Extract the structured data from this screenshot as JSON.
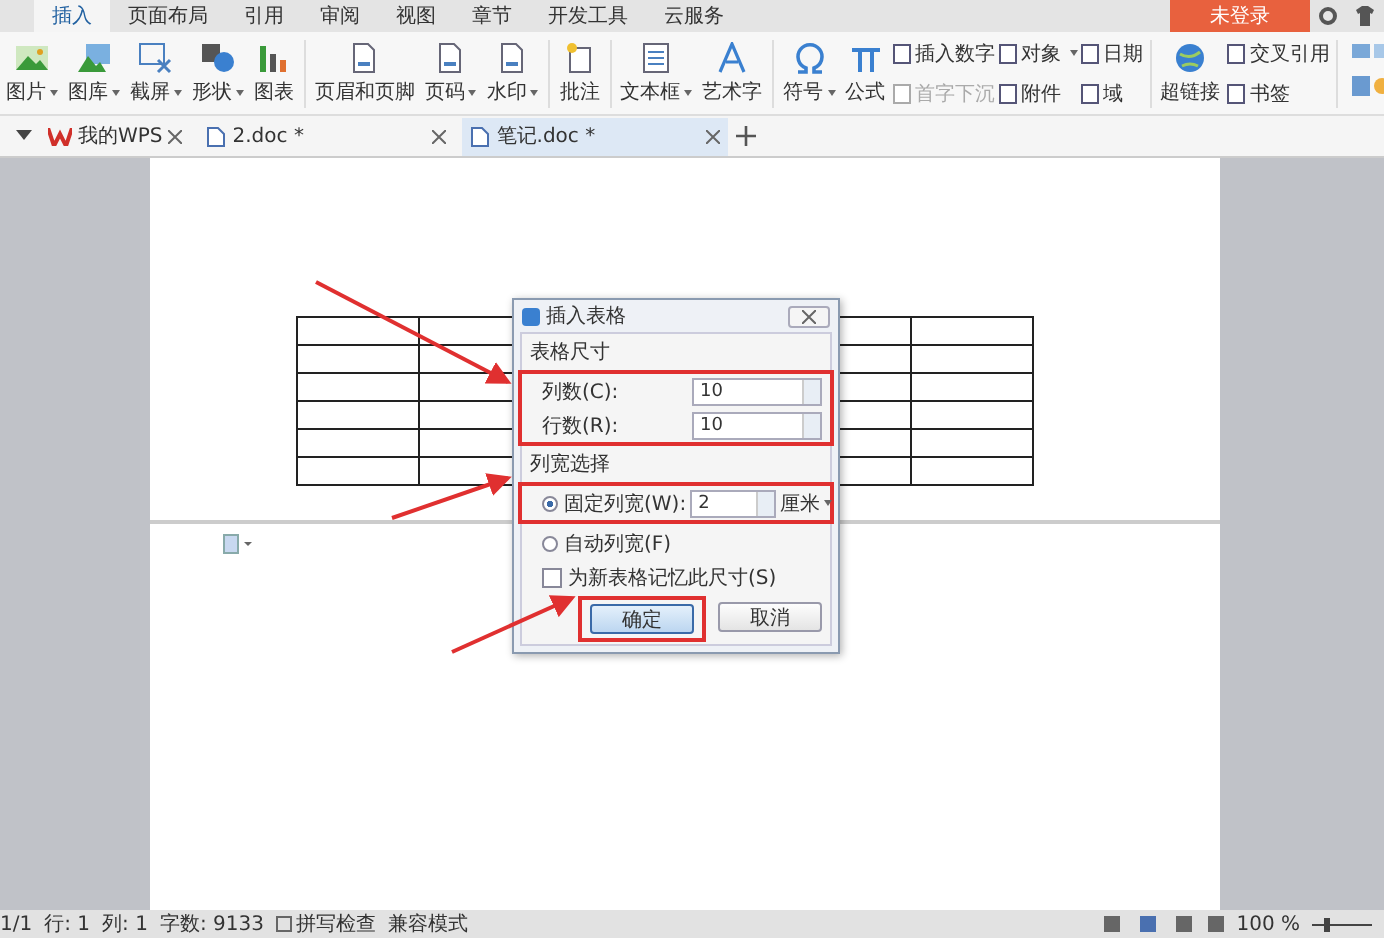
{
  "menu_tabs": [
    {
      "label": "插入",
      "selected": true
    },
    {
      "label": "页面布局",
      "selected": false
    },
    {
      "label": "引用",
      "selected": false
    },
    {
      "label": "审阅",
      "selected": false
    },
    {
      "label": "视图",
      "selected": false
    },
    {
      "label": "章节",
      "selected": false
    },
    {
      "label": "开发工具",
      "selected": false
    },
    {
      "label": "云服务",
      "selected": false
    }
  ],
  "login_button": "未登录",
  "ribbon": [
    {
      "kind": "large",
      "label": "图片",
      "dropdown": true
    },
    {
      "kind": "large",
      "label": "图库",
      "dropdown": true
    },
    {
      "kind": "large",
      "label": "截屏",
      "dropdown": true
    },
    {
      "kind": "large",
      "label": "形状",
      "dropdown": true
    },
    {
      "kind": "large",
      "label": "图表",
      "dropdown": false
    },
    {
      "kind": "separator"
    },
    {
      "kind": "large",
      "label": "页眉和页脚",
      "dropdown": false
    },
    {
      "kind": "large",
      "label": "页码",
      "dropdown": true
    },
    {
      "kind": "large",
      "label": "水印",
      "dropdown": true
    },
    {
      "kind": "separator"
    },
    {
      "kind": "large",
      "label": "批注",
      "dropdown": false
    },
    {
      "kind": "separator"
    },
    {
      "kind": "large",
      "label": "文本框",
      "dropdown": true
    },
    {
      "kind": "large",
      "label": "艺术字",
      "dropdown": false
    },
    {
      "kind": "separator"
    },
    {
      "kind": "large",
      "label": "符号",
      "dropdown": true
    },
    {
      "kind": "large",
      "label": "公式",
      "dropdown": false
    },
    {
      "kind": "small",
      "items": [
        {
          "label": "插入数字",
          "dropdown": false,
          "disabled": false
        },
        {
          "label": "首字下沉",
          "dropdown": false,
          "disabled": true
        }
      ]
    },
    {
      "kind": "small",
      "items": [
        {
          "label": "对象",
          "dropdown": true,
          "disabled": false
        },
        {
          "label": "附件",
          "dropdown": false,
          "disabled": false
        }
      ]
    },
    {
      "kind": "small",
      "items": [
        {
          "label": "日期",
          "dropdown": false,
          "disabled": false
        },
        {
          "label": "域",
          "dropdown": false,
          "disabled": false
        }
      ]
    },
    {
      "kind": "separator"
    },
    {
      "kind": "large",
      "label": "超链接",
      "dropdown": false
    },
    {
      "kind": "small",
      "items": [
        {
          "label": "交叉引用",
          "dropdown": false,
          "disabled": false
        },
        {
          "label": "书签",
          "dropdown": false,
          "disabled": false
        }
      ]
    },
    {
      "kind": "separator"
    },
    {
      "kind": "grid"
    }
  ],
  "doc_tabs": [
    {
      "label": "我的WPS",
      "selected": false,
      "kind": "wps"
    },
    {
      "label": "2.doc *",
      "selected": false,
      "kind": "doc"
    },
    {
      "label": "笔记.doc *",
      "selected": true,
      "kind": "doc"
    }
  ],
  "dialog": {
    "title": "插入表格",
    "size_section": "表格尺寸",
    "fields": [
      {
        "label": "列数(C):",
        "value": "10"
      },
      {
        "label": "行数(R):",
        "value": "10"
      }
    ],
    "width_section": "列宽选择",
    "options": [
      {
        "label": "固定列宽(W):",
        "selected": true,
        "value": "2",
        "unit": "厘米"
      },
      {
        "label": "自动列宽(F)",
        "selected": false
      }
    ],
    "remember": {
      "label": "为新表格记忆此尺寸(S)",
      "checked": false
    },
    "buttons": [
      {
        "label": "确定",
        "default": true
      },
      {
        "label": "取消",
        "default": false
      }
    ]
  },
  "status_bar": {
    "items": [
      "1/1",
      "行: 1",
      "列: 1",
      "字数: 9133"
    ],
    "spellcheck": {
      "label": "拼写检查",
      "checked": false
    },
    "mode": "兼容模式",
    "zoom": "100 %",
    "zoom_slider": {
      "level": 0.2
    }
  }
}
